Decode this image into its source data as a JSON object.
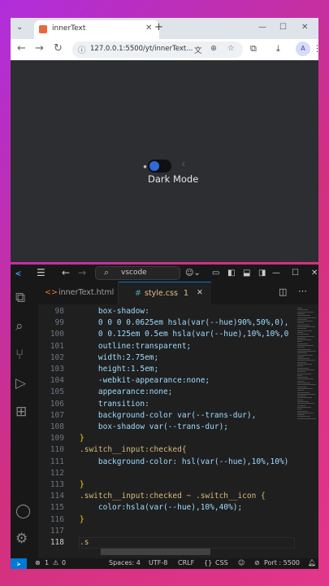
{
  "browser": {
    "tab_title": "innerText",
    "url": "127.0.0.1:5500/yt/innerText...",
    "new_tab": "+",
    "profile_initial": "A",
    "page": {
      "toggle_label": "Dark Mode"
    }
  },
  "vscode": {
    "search": "vscode",
    "tabs": [
      {
        "label": "innerText.html",
        "active": false
      },
      {
        "label": "style.css",
        "active": true,
        "badge": "1"
      }
    ],
    "lines": [
      {
        "n": "98",
        "text": "    box-shadow:"
      },
      {
        "n": "99",
        "text": "    0 0 0 0.0625em hsla(var(--hue)90%,50%,0),"
      },
      {
        "n": "100",
        "text": "    0 0.125em 0.5em hsla(var(--hue),10%,10%,0"
      },
      {
        "n": "101",
        "text": "    outline:transparent;"
      },
      {
        "n": "102",
        "text": "    width:2.75em;"
      },
      {
        "n": "103",
        "text": "    height:1.5em;"
      },
      {
        "n": "104",
        "text": "    -webkit-appearance:none;"
      },
      {
        "n": "105",
        "text": "    appearance:none;"
      },
      {
        "n": "106",
        "text": "    transition:"
      },
      {
        "n": "107",
        "text": "    background-color var(--trans-dur),"
      },
      {
        "n": "108",
        "text": "    box-shadow var(--trans-dur);"
      },
      {
        "n": "109",
        "text": "}"
      },
      {
        "n": "110",
        "text": ".switch__input:checked{"
      },
      {
        "n": "111",
        "text": "    background-color: hsl(var(--hue),10%,10%)"
      },
      {
        "n": "112",
        "text": ""
      },
      {
        "n": "113",
        "text": "}"
      },
      {
        "n": "114",
        "text": ".switch__input:checked ~ .switch__icon {"
      },
      {
        "n": "115",
        "text": "    color:hsla(var(--hue),10%,40%);"
      },
      {
        "n": "116",
        "text": "}"
      },
      {
        "n": "117",
        "text": ""
      },
      {
        "n": "118",
        "text": ".s"
      }
    ],
    "status": {
      "errors": "1",
      "warnings": "0",
      "spaces": "Spaces: 4",
      "encoding": "UTF-8",
      "eol": "CRLF",
      "language": "CSS",
      "port": "Port : 5500"
    }
  },
  "colors": {
    "accent": "#0078d4",
    "background_gradient": [
      "#b02edc",
      "#e2368a"
    ],
    "editor_bg": "#1f1f1f",
    "toggle_knob": "#2f6ad6"
  },
  "icons": [
    "chevron-down-icon",
    "back-icon",
    "forward-icon",
    "reload-icon",
    "site-info-icon",
    "translate-icon",
    "zoom-icon",
    "bookmark-star-icon",
    "extensions-icon",
    "download-icon",
    "menu-icon",
    "explorer-icon",
    "search-icon",
    "source-control-icon",
    "run-debug-icon",
    "extensions-icon",
    "account-icon",
    "settings-icon",
    "copilot-icon"
  ]
}
